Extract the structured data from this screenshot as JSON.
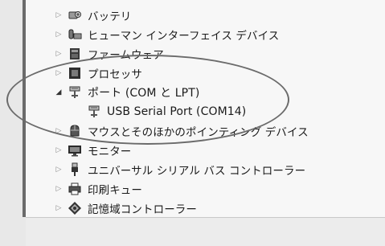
{
  "device_tree": {
    "items": [
      {
        "label": "バッテリ",
        "icon": "battery-icon",
        "expanded": false
      },
      {
        "label": "ヒューマン インターフェイス デバイス",
        "icon": "hid-icon",
        "expanded": false
      },
      {
        "label": "ファームウェア",
        "icon": "firmware-icon",
        "expanded": false
      },
      {
        "label": "プロセッサ",
        "icon": "processor-icon",
        "expanded": false
      },
      {
        "label": "ポート (COM と LPT)",
        "icon": "port-icon",
        "expanded": true
      },
      {
        "label": "USB Serial Port (COM14)",
        "icon": "port-icon",
        "child": true
      },
      {
        "label": "マウスとそのほかのポインティング デバイス",
        "icon": "mouse-icon",
        "expanded": false
      },
      {
        "label": "モニター",
        "icon": "monitor-icon",
        "expanded": false
      },
      {
        "label": "ユニバーサル シリアル バス コントローラー",
        "icon": "usb-icon",
        "expanded": false
      },
      {
        "label": "印刷キュー",
        "icon": "printer-icon",
        "expanded": false
      },
      {
        "label": "記憶域コントローラー",
        "icon": "storage-icon",
        "expanded": false
      }
    ]
  },
  "colors": {
    "background": "#f7f7f7",
    "annotation_ellipse": "#6b6b6b",
    "rail": "#6a6a6a"
  }
}
